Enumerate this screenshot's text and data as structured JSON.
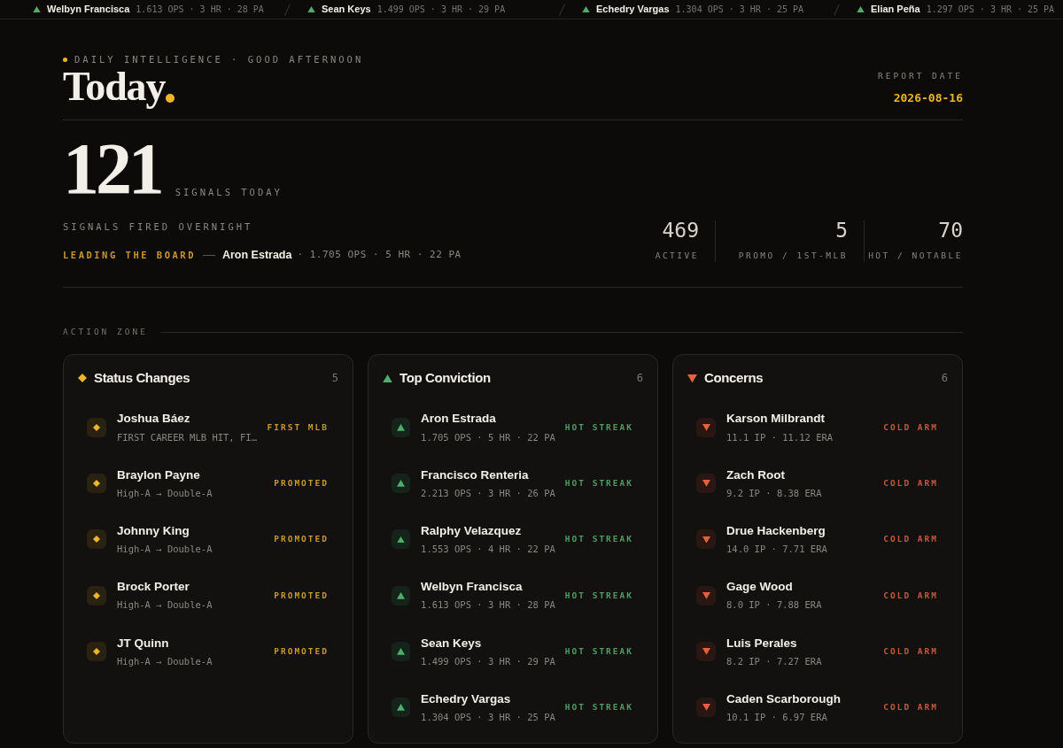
{
  "ticker": [
    {
      "name": "Welbyn Francisca",
      "stats": "1.613 OPS · 3 HR · 28 PA"
    },
    {
      "name": "Sean Keys",
      "stats": "1.499 OPS · 3 HR · 29 PA"
    },
    {
      "name": "Echedry Vargas",
      "stats": "1.304 OPS · 3 HR · 25 PA"
    },
    {
      "name": "Elian Peña",
      "stats": "1.297 OPS · 3 HR · 25 PA"
    }
  ],
  "eyebrow": "DAILY INTELLIGENCE · GOOD AFTERNOON",
  "title": "Today",
  "report_date": {
    "label": "REPORT DATE",
    "value": "2026-08-16"
  },
  "signals": {
    "count": "121",
    "count_label": "SIGNALS TODAY",
    "caption": "SIGNALS FIRED OVERNIGHT",
    "leader_label": "LEADING THE BOARD",
    "leader_name": "Aron Estrada",
    "leader_stats": "· 1.705 OPS · 5 HR · 22 PA"
  },
  "stats": [
    {
      "value": "469",
      "label": "ACTIVE"
    },
    {
      "value": "5",
      "label": "PROMO / 1ST-MLB"
    },
    {
      "value": "70",
      "label": "HOT / NOTABLE"
    }
  ],
  "section_title": "ACTION ZONE",
  "panels": [
    {
      "kind": "status",
      "title": "Status Changes",
      "count": "5",
      "items": [
        {
          "name": "Joshua Báez",
          "detail": "FIRST CAREER MLB HIT, FI…",
          "tag": "FIRST MLB"
        },
        {
          "name": "Braylon Payne",
          "detail": "High-A → Double-A",
          "tag": "PROMOTED"
        },
        {
          "name": "Johnny King",
          "detail": "High-A → Double-A",
          "tag": "PROMOTED"
        },
        {
          "name": "Brock Porter",
          "detail": "High-A → Double-A",
          "tag": "PROMOTED"
        },
        {
          "name": "JT Quinn",
          "detail": "High-A → Double-A",
          "tag": "PROMOTED"
        }
      ]
    },
    {
      "kind": "up",
      "title": "Top Conviction",
      "count": "6",
      "items": [
        {
          "name": "Aron Estrada",
          "detail": "1.705 OPS · 5 HR · 22 PA",
          "tag": "HOT STREAK"
        },
        {
          "name": "Francisco Renteria",
          "detail": "2.213 OPS · 3 HR · 26 PA",
          "tag": "HOT STREAK"
        },
        {
          "name": "Ralphy Velazquez",
          "detail": "1.553 OPS · 4 HR · 22 PA",
          "tag": "HOT STREAK"
        },
        {
          "name": "Welbyn Francisca",
          "detail": "1.613 OPS · 3 HR · 28 PA",
          "tag": "HOT STREAK"
        },
        {
          "name": "Sean Keys",
          "detail": "1.499 OPS · 3 HR · 29 PA",
          "tag": "HOT STREAK"
        },
        {
          "name": "Echedry Vargas",
          "detail": "1.304 OPS · 3 HR · 25 PA",
          "tag": "HOT STREAK"
        }
      ]
    },
    {
      "kind": "down",
      "title": "Concerns",
      "count": "6",
      "items": [
        {
          "name": "Karson Milbrandt",
          "detail": "11.1 IP · 11.12 ERA",
          "tag": "COLD ARM"
        },
        {
          "name": "Zach Root",
          "detail": "9.2 IP · 8.38 ERA",
          "tag": "COLD ARM"
        },
        {
          "name": "Drue Hackenberg",
          "detail": "14.0 IP · 7.71 ERA",
          "tag": "COLD ARM"
        },
        {
          "name": "Gage Wood",
          "detail": "8.0 IP · 7.88 ERA",
          "tag": "COLD ARM"
        },
        {
          "name": "Luis Perales",
          "detail": "8.2 IP · 7.27 ERA",
          "tag": "COLD ARM"
        },
        {
          "name": "Caden Scarborough",
          "detail": "10.1 IP · 6.97 ERA",
          "tag": "COLD ARM"
        }
      ]
    }
  ]
}
